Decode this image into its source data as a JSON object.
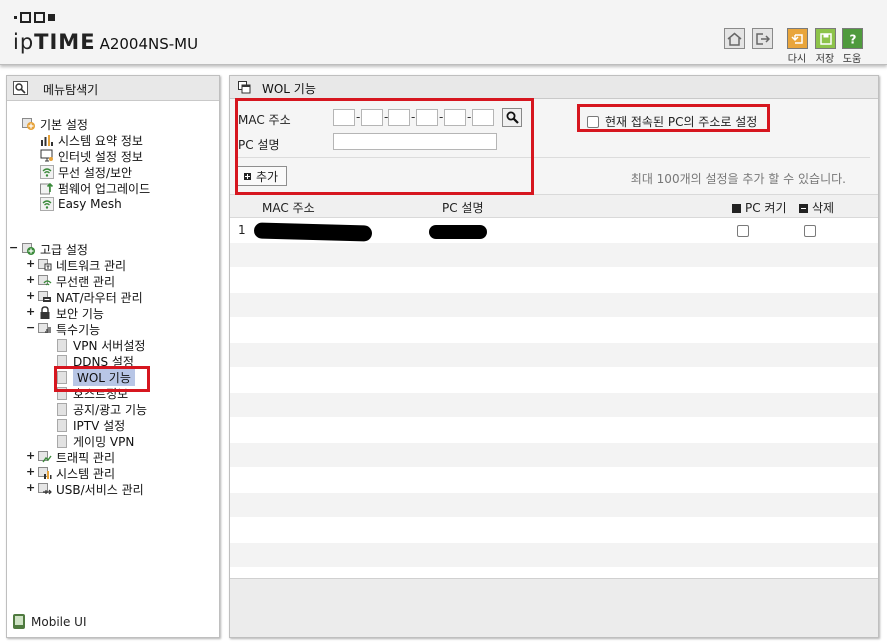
{
  "header": {
    "brand_ip": "ip",
    "brand_time": "TIME",
    "model": "A2004NS-MU",
    "toolbar": [
      {
        "name": "home-icon"
      },
      {
        "name": "logout-icon"
      },
      {
        "name": "refresh-icon",
        "label": "다시",
        "color": "#e9a53b"
      },
      {
        "name": "save-icon",
        "label": "저장",
        "color": "#8dc34a"
      },
      {
        "name": "help-icon",
        "label": "도움",
        "color": "#4f9a3d"
      }
    ]
  },
  "menu": {
    "title": "메뉴탐색기",
    "basic": {
      "label": "기본 설정",
      "items": [
        "시스템 요약 정보",
        "인터넷 설정 정보",
        "무선 설정/보안",
        "펌웨어 업그레이드",
        "Easy Mesh"
      ]
    },
    "advanced": {
      "label": "고급 설정",
      "groups": [
        "네트워크 관리",
        "무선랜 관리",
        "NAT/라우터 관리",
        "보안 기능",
        "특수기능"
      ],
      "special_items": [
        "VPN 서버설정",
        "DDNS 설정",
        "WOL 기능",
        "호스트정보",
        "공지/광고 기능",
        "IPTV 설정",
        "게이밍 VPN"
      ],
      "more_groups": [
        "트래픽 관리",
        "시스템 관리",
        "USB/서비스 관리"
      ]
    },
    "mobile": "Mobile UI"
  },
  "wol": {
    "title": "WOL 기능",
    "mac_label": "MAC 주소",
    "pc_label": "PC 설명",
    "add_label": "추가",
    "current_pc_label": "현재 접속된 PC의 주소로 설정",
    "max_note": "최대 100개의 설정을 추가 할 수 있습니다.",
    "columns": {
      "mac": "MAC 주소",
      "pc": "PC 설명",
      "power": "PC 켜기",
      "delete": "삭제"
    },
    "rows": [
      {
        "num": "1"
      }
    ]
  },
  "colors": {
    "highlight_red": "#d6161f",
    "selected_bg": "#b8c6e6"
  }
}
